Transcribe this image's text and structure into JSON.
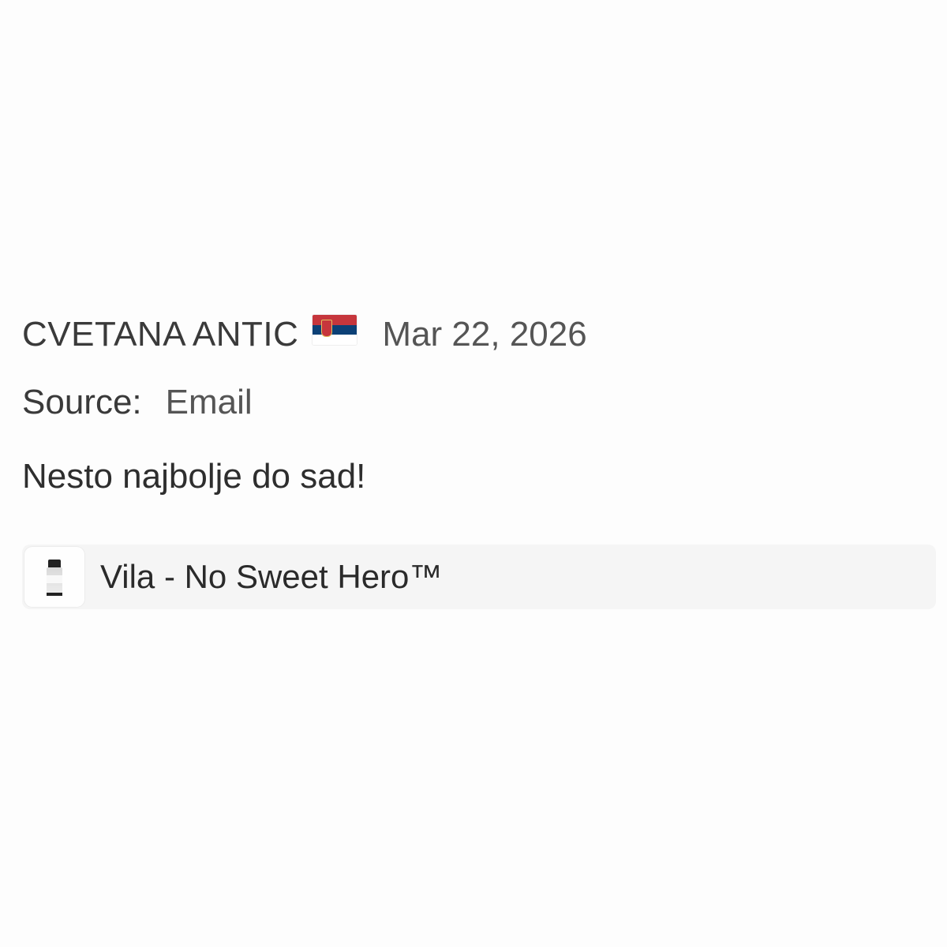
{
  "review": {
    "reviewer_name": "CVETANA ANTIC",
    "country_flag_icon": "serbia-flag-icon",
    "date": "Mar 22, 2026",
    "source_label": "Source:",
    "source_value": "Email",
    "text": "Nesto najbolje do sad!",
    "product": {
      "thumbnail_icon": "supplement-jar-icon",
      "name": "Vila - No Sweet Hero™"
    }
  },
  "colors": {
    "background": "#fdfdfd",
    "product_chip_background": "#f5f5f5",
    "text_primary": "#2a2a2a",
    "text_secondary": "#555555"
  }
}
